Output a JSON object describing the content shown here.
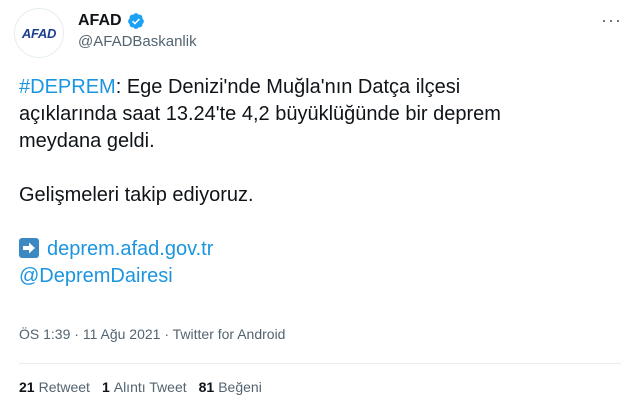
{
  "author": {
    "display_name": "AFAD",
    "handle": "@AFADBaskanlik",
    "avatar_text": "AFAD",
    "verified_icon": "verified-badge-icon"
  },
  "tweet": {
    "hashtag": "#DEPREM",
    "line1_rest": ": Ege Denizi'nde Muğla'nın Datça ilçesi",
    "line2": "açıklarında saat 13.24'te 4,2 büyüklüğünde bir deprem",
    "line3": "meydana geldi.",
    "line4": "Gelişmeleri takip ediyoruz.",
    "link1": "deprem.afad.gov.tr",
    "link2": "@DepremDairesi",
    "more_icon": "···"
  },
  "meta": {
    "time": "ÖS 1:39",
    "sep1": " · ",
    "date": "11 Ağu 2021",
    "sep2": " · ",
    "source": "Twitter for Android"
  },
  "stats": {
    "retweets_count": "21",
    "retweets_label": "Retweet",
    "quotes_count": "1",
    "quotes_label": "Alıntı Tweet",
    "likes_count": "81",
    "likes_label": "Beğeni"
  },
  "colors": {
    "link": "#1b95e0",
    "verified": "#1da1f2",
    "arrow_box": "#3b88c3"
  }
}
